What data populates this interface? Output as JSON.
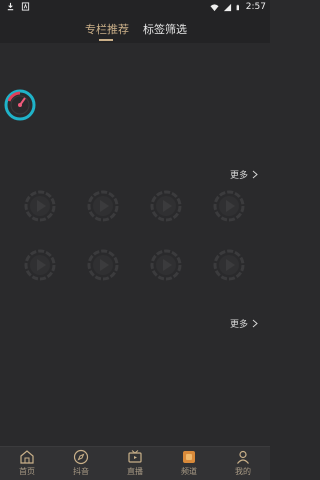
{
  "status_bar": {
    "time": "2:57"
  },
  "header": {
    "tabs": [
      {
        "label": "专栏推荐",
        "active": true
      },
      {
        "label": "标签筛选",
        "active": false
      }
    ]
  },
  "sections": [
    {
      "more_label": "更多"
    },
    {
      "more_label": "更多"
    }
  ],
  "bottom_nav": {
    "items": [
      {
        "label": "首页",
        "icon": "home-icon"
      },
      {
        "label": "抖音",
        "icon": "compass-icon"
      },
      {
        "label": "直播",
        "icon": "tv-icon"
      },
      {
        "label": "频道",
        "icon": "channel-icon"
      },
      {
        "label": "我的",
        "icon": "profile-icon"
      }
    ]
  },
  "colors": {
    "accent": "#cbb089",
    "background": "#2a2a2c",
    "header": "#232325",
    "nav": "#323234"
  }
}
